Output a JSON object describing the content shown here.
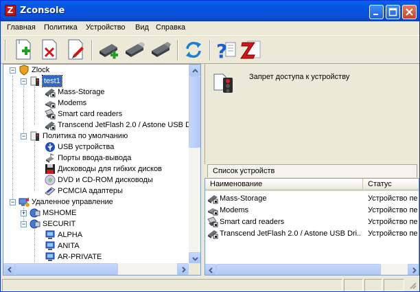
{
  "window": {
    "title": "Zconsole",
    "logo_letter": "Z"
  },
  "menu": [
    {
      "label": "Главная"
    },
    {
      "label": "Политика"
    },
    {
      "label": "Устройство"
    },
    {
      "label": "Вид"
    },
    {
      "label": "Справка"
    }
  ],
  "toolbar": {
    "buttons": [
      {
        "name": "new-policy",
        "icon": "add-document-icon"
      },
      {
        "name": "delete-policy",
        "icon": "delete-document-icon"
      },
      {
        "name": "edit-policy",
        "icon": "edit-document-icon"
      },
      {
        "name": "add-device",
        "icon": "usb-add-icon"
      },
      {
        "name": "device-2",
        "icon": "usb-icon"
      },
      {
        "name": "device-3",
        "icon": "usb-icon"
      },
      {
        "name": "refresh",
        "icon": "refresh-icon"
      },
      {
        "name": "help",
        "icon": "help-icon"
      },
      {
        "name": "about",
        "icon": "zlock-icon"
      }
    ]
  },
  "tree": {
    "root": "Zlock",
    "policy_name": "test1",
    "policy_children": [
      "Mass-Storage",
      "Modems",
      "Smart card readers",
      "Transcend JetFlash 2.0 / Astone USB Dr"
    ],
    "default_policy": "Политика по умолчанию",
    "default_children": [
      "USB устройства",
      "Порты ввода-вывода",
      "Дисководы для гибких дисков",
      "DVD и CD-ROM дисководы",
      "PCMCIA адаптеры"
    ],
    "remote": "Удаленное управление",
    "remote_children": [
      "MSHOME",
      "SECURIT"
    ],
    "securit_children": [
      "ALPHA",
      "ANITA",
      "AR-PRIVATE"
    ]
  },
  "details": {
    "description": "Запрет доступа к устройству",
    "section_title": "Список устройств",
    "columns": [
      "Наименование",
      "Статус"
    ],
    "rows": [
      {
        "name": "Mass-Storage",
        "status": "Устройство пе"
      },
      {
        "name": "Modems",
        "status": "Устройство пе"
      },
      {
        "name": "Smart card readers",
        "status": "Устройство пе"
      },
      {
        "name": "Transcend JetFlash 2.0 / Astone USB Dri...",
        "status": "Устройство пе"
      }
    ]
  }
}
